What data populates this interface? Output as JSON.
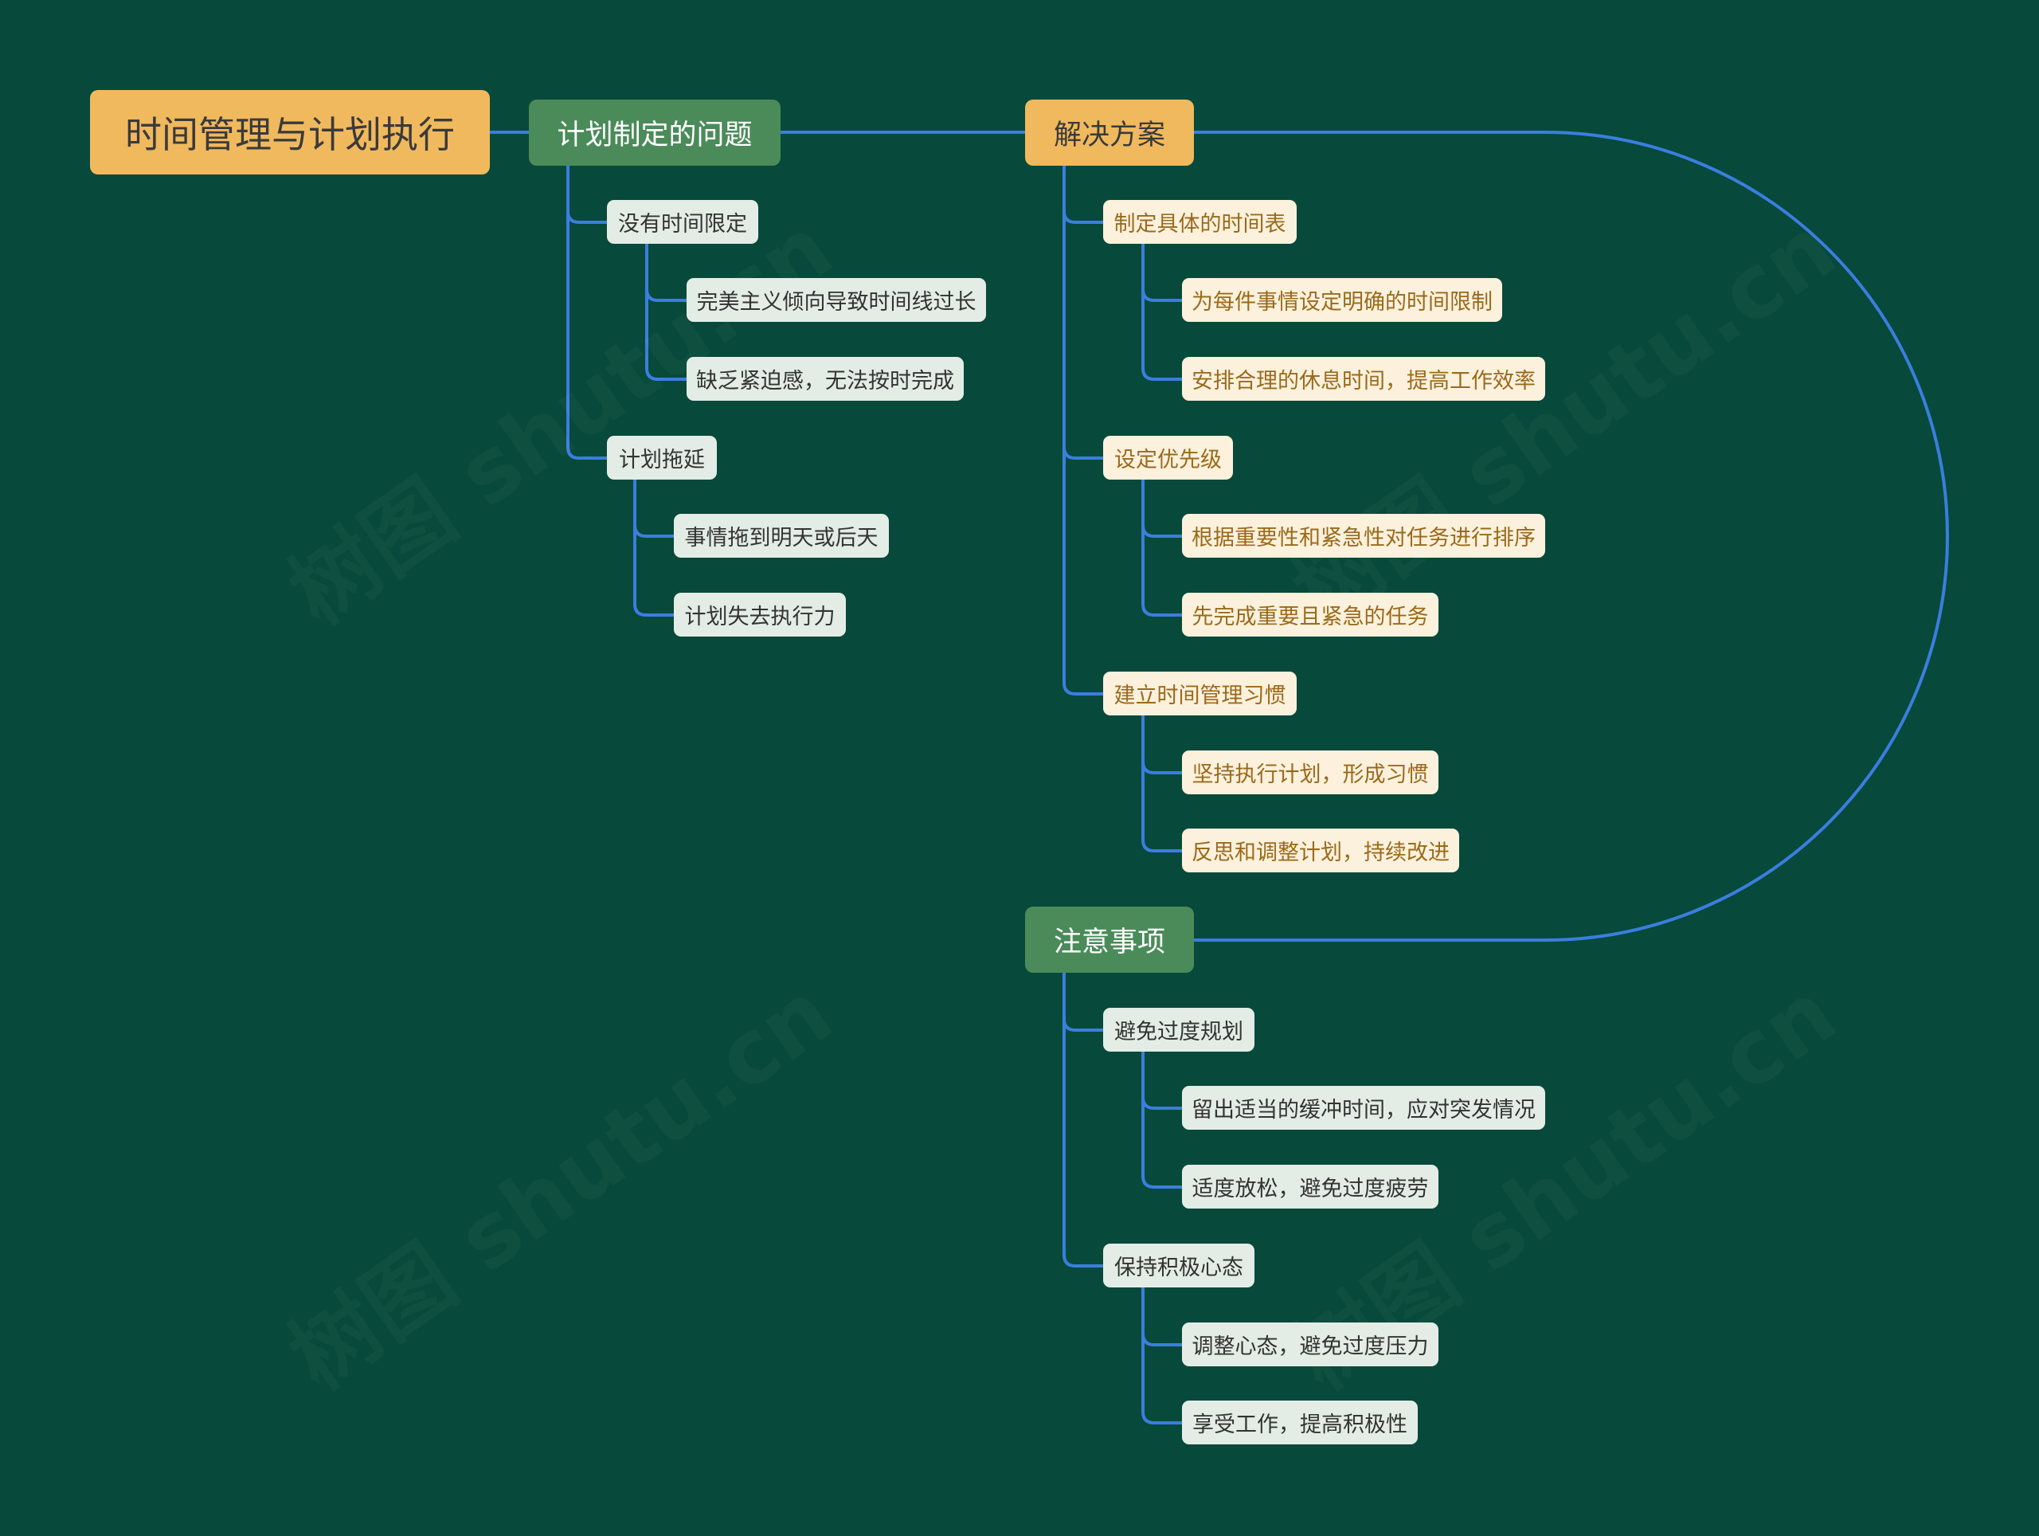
{
  "colors": {
    "background": "#07493a",
    "connector": "#3a7ee0",
    "root_fill": "#f0b95e",
    "green_fill": "#4b8b5a",
    "orange_fill": "#f0b95e",
    "pale_fill": "#e3ede6",
    "cream_fill": "#fcf1dc",
    "cream_text": "#9a6a1c"
  },
  "watermark": "树图 shutu.cn",
  "root": {
    "label": "时间管理与计划执行"
  },
  "branches": [
    {
      "label": "计划制定的问题",
      "style": "green",
      "topics": [
        {
          "label": "没有时间限定",
          "items": [
            "完美主义倾向导致时间线过长",
            "缺乏紧迫感，无法按时完成"
          ]
        },
        {
          "label": "计划拖延",
          "items": [
            "事情拖到明天或后天",
            "计划失去执行力"
          ]
        }
      ]
    },
    {
      "label": "解决方案",
      "style": "orange",
      "topics": [
        {
          "label": "制定具体的时间表",
          "items": [
            "为每件事情设定明确的时间限制",
            "安排合理的休息时间，提高工作效率"
          ]
        },
        {
          "label": "设定优先级",
          "items": [
            "根据重要性和紧急性对任务进行排序",
            "先完成重要且紧急的任务"
          ]
        },
        {
          "label": "建立时间管理习惯",
          "items": [
            "坚持执行计划，形成习惯",
            "反思和调整计划，持续改进"
          ]
        }
      ]
    },
    {
      "label": "注意事项",
      "style": "green",
      "topics": [
        {
          "label": "避免过度规划",
          "items": [
            "留出适当的缓冲时间，应对突发情况",
            "适度放松，避免过度疲劳"
          ]
        },
        {
          "label": "保持积极心态",
          "items": [
            "调整心态，避免过度压力",
            "享受工作，提高积极性"
          ]
        }
      ]
    }
  ]
}
